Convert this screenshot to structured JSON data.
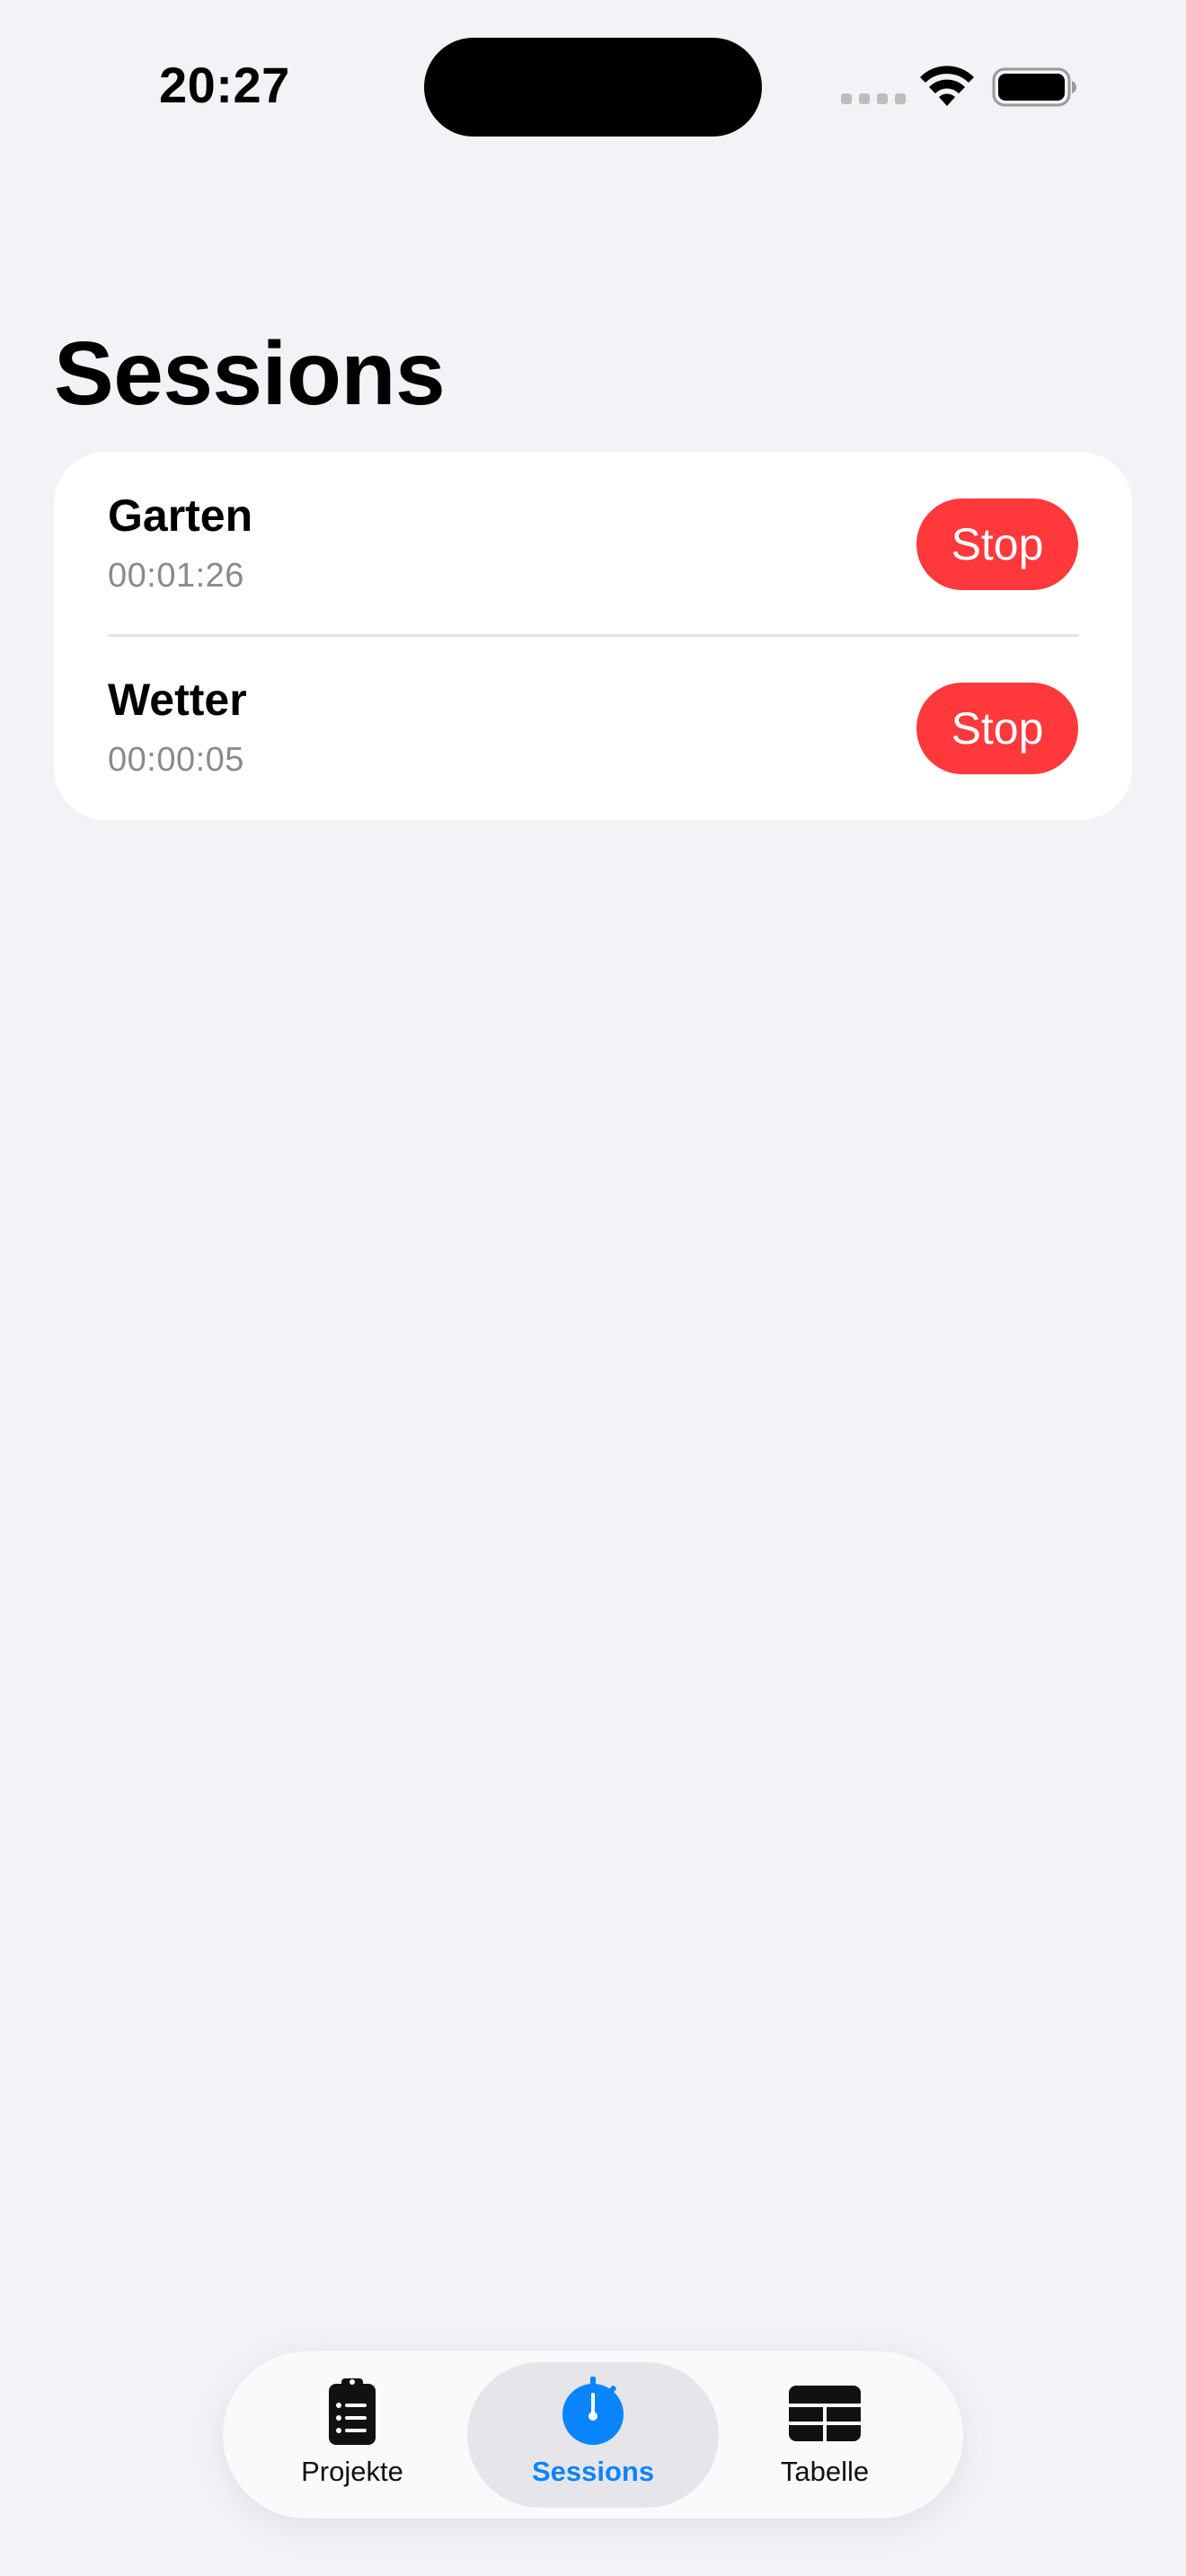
{
  "status_bar": {
    "time": "20:27"
  },
  "page": {
    "title": "Sessions"
  },
  "sessions": [
    {
      "name": "Garten",
      "elapsed": "00:01:26",
      "action_label": "Stop"
    },
    {
      "name": "Wetter",
      "elapsed": "00:00:05",
      "action_label": "Stop"
    }
  ],
  "tab_bar": {
    "tabs": [
      {
        "label": "Projekte",
        "icon": "clipboard-list-icon",
        "selected": false
      },
      {
        "label": "Sessions",
        "icon": "stopwatch-icon",
        "selected": true
      },
      {
        "label": "Tabelle",
        "icon": "table-icon",
        "selected": false
      }
    ]
  },
  "colors": {
    "accent": "#0A84FF",
    "stop_button": "#FF383C",
    "background": "#F2F2F7"
  }
}
